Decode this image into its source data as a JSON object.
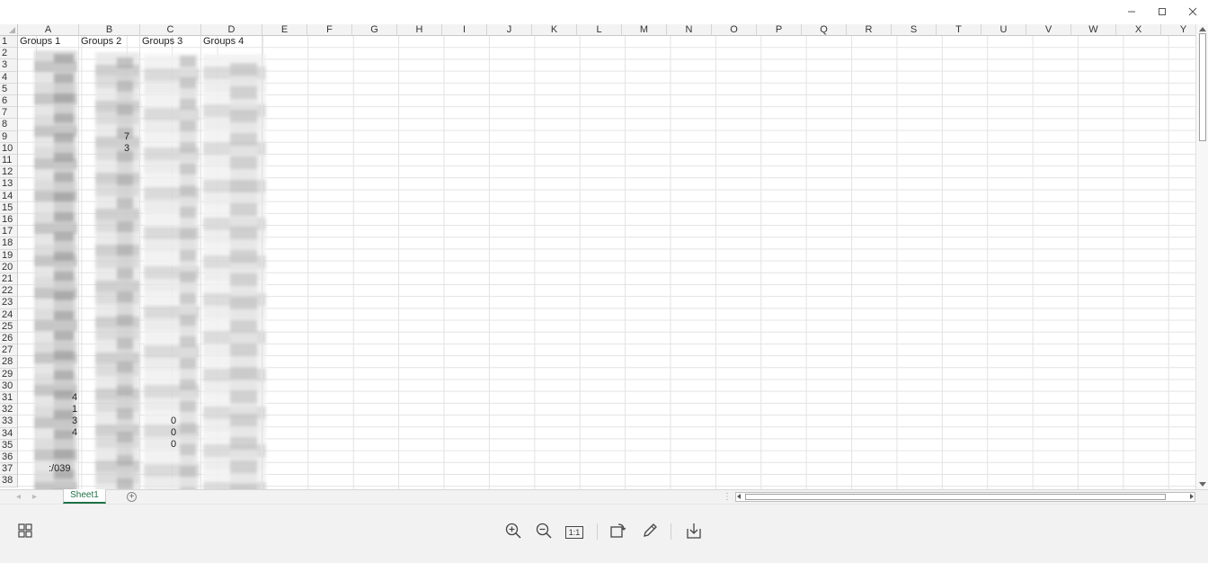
{
  "window": {
    "controls": [
      {
        "name": "minimize-button",
        "icon": "minimize-icon"
      },
      {
        "name": "maximize-button",
        "icon": "maximize-icon"
      },
      {
        "name": "close-button",
        "icon": "close-icon"
      }
    ]
  },
  "spreadsheet": {
    "columns": [
      "A",
      "B",
      "C",
      "D",
      "E",
      "F",
      "G",
      "H",
      "I",
      "J",
      "K",
      "L",
      "M",
      "N",
      "O",
      "P",
      "Q",
      "R",
      "S",
      "T",
      "U",
      "V",
      "W",
      "X",
      "Y"
    ],
    "rows": [
      "1",
      "2",
      "3",
      "4",
      "5",
      "6",
      "7",
      "8",
      "9",
      "10",
      "11",
      "12",
      "13",
      "14",
      "15",
      "16",
      "17",
      "18",
      "19",
      "20",
      "21",
      "22",
      "23",
      "24",
      "25",
      "26",
      "27",
      "28",
      "29",
      "30",
      "31",
      "32",
      "33",
      "34",
      "35",
      "36",
      "37",
      "38"
    ],
    "header_cells": {
      "A1": "Groups 1",
      "B1": "Groups 2",
      "C1": "Groups 3",
      "D1": "Groups 4"
    },
    "fragments": [
      {
        "text": "7"
      },
      {
        "text": "3"
      },
      {
        "text": "4"
      },
      {
        "text": "1"
      },
      {
        "text": "3"
      },
      {
        "text": "4"
      },
      {
        "text": "0"
      },
      {
        "text": "0"
      },
      {
        "text": "0"
      },
      {
        "text": ":/039"
      }
    ]
  },
  "sheets": {
    "tabs": [
      "Sheet1"
    ],
    "add_label": "+",
    "split_label": "⋮"
  },
  "toolbar": {
    "grid_view_icon": "grid-view-icon",
    "tools": [
      "zoom-in-icon",
      "zoom-out-icon",
      "actual-size-icon",
      "rotate-icon",
      "edit-pen-icon",
      "download-icon"
    ],
    "actual_size_label": "1:1"
  },
  "colors": {
    "accent": "#1e7145",
    "header_bg": "#f3f3f3",
    "gridline": "#e3e3e3",
    "toolbar_bg": "#f2f2f2"
  }
}
